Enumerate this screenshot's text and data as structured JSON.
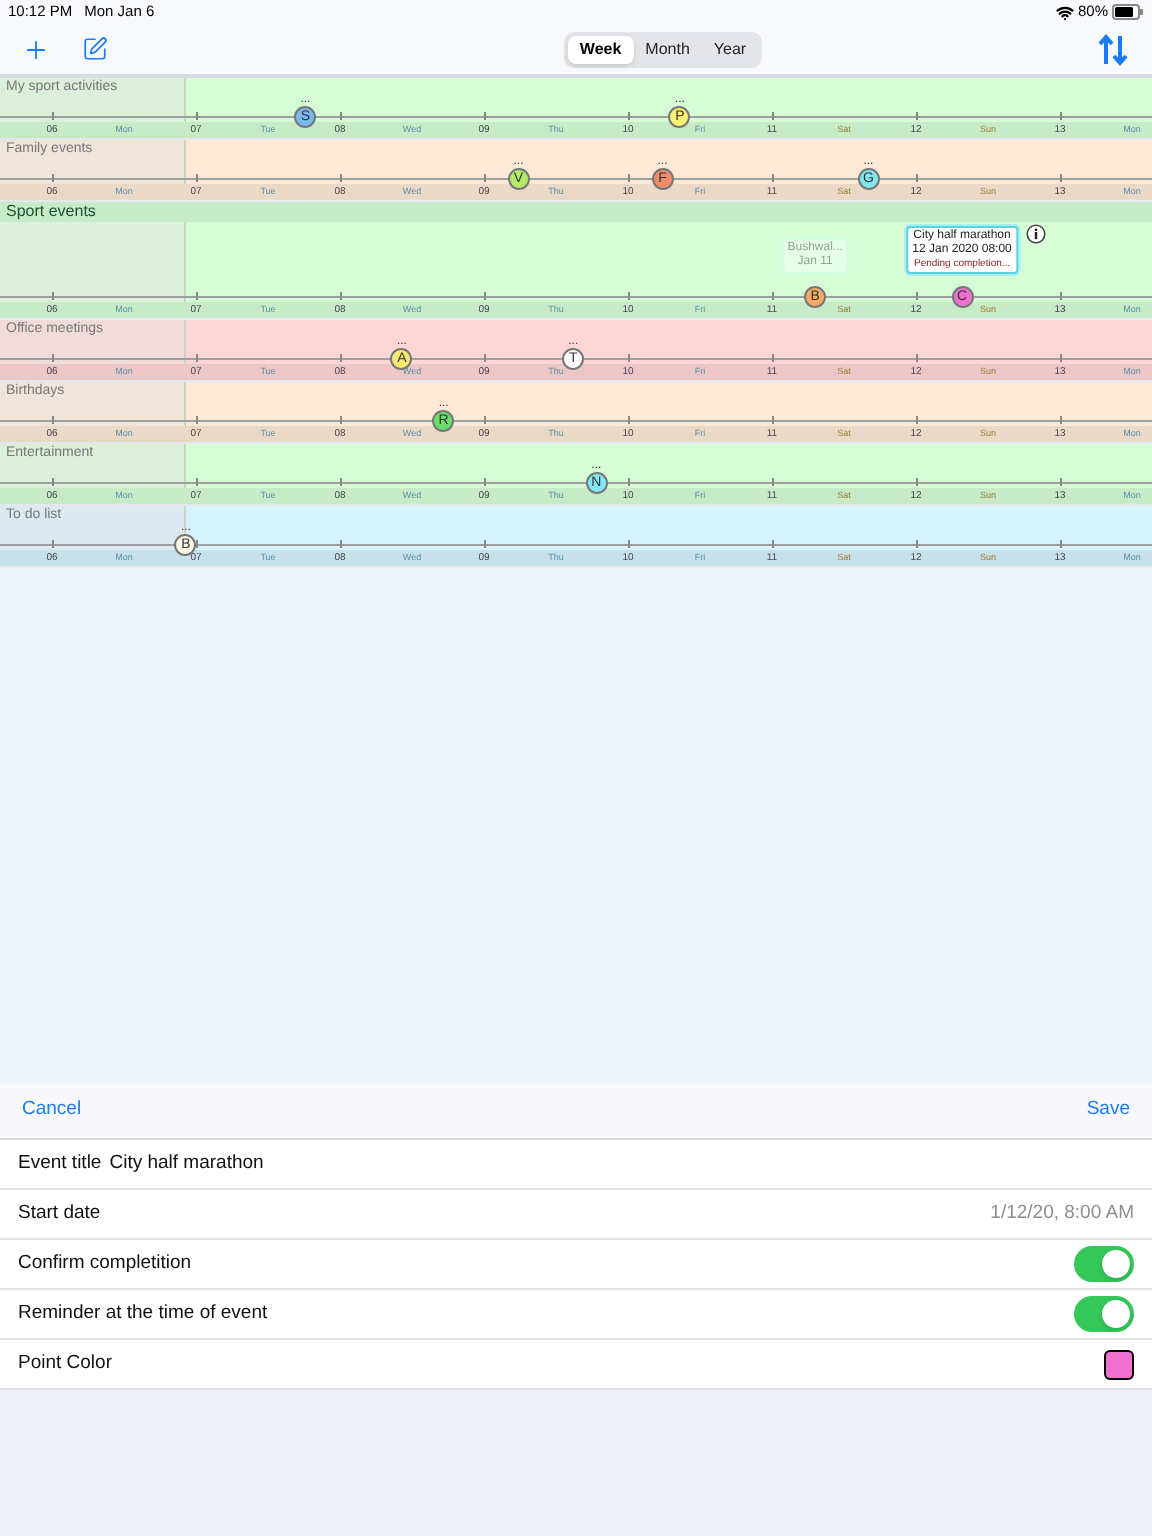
{
  "status_bar": {
    "time": "10:12 PM",
    "date": "Mon Jan 6",
    "battery": "80%"
  },
  "toolbar": {
    "segments": [
      {
        "label": "Week",
        "selected": true
      },
      {
        "label": "Month",
        "selected": false
      },
      {
        "label": "Year",
        "selected": false
      }
    ]
  },
  "timelines": [
    {
      "name": "My sport activities",
      "color": "#d6fcd6",
      "expanded": false,
      "dates": [
        "06",
        "07",
        "08",
        "09",
        "10",
        "11",
        "12",
        "13"
      ],
      "weekdays": [
        "Mon",
        "Tue",
        "Wed",
        "Thu",
        "Fri",
        "Sat",
        "Sun",
        "Mon"
      ],
      "points": [
        {
          "letter": "S",
          "color": "#7ab8f0",
          "more": "..."
        },
        {
          "letter": "P",
          "color": "#f8f270",
          "more": "..."
        }
      ]
    },
    {
      "name": "Family events",
      "color": "#fde9d6",
      "expanded": false,
      "dates": [
        "06",
        "07",
        "08",
        "09",
        "10",
        "11",
        "12",
        "13"
      ],
      "weekdays": [
        "Mon",
        "Tue",
        "Wed",
        "Thu",
        "Fri",
        "Sat",
        "Sun",
        "Mon"
      ],
      "points": [
        {
          "letter": "V",
          "color": "#b6ea6a",
          "more": "..."
        },
        {
          "letter": "F",
          "color": "#f08c6c",
          "more": "..."
        },
        {
          "letter": "G",
          "color": "#80e8f0",
          "more": "..."
        }
      ]
    },
    {
      "name": "Sport events",
      "color": "#d6fcd6",
      "expanded": true,
      "dates": [
        "06",
        "07",
        "08",
        "09",
        "10",
        "11",
        "12",
        "13"
      ],
      "weekdays": [
        "Mon",
        "Tue",
        "Wed",
        "Thu",
        "Fri",
        "Sat",
        "Sun",
        "Mon"
      ],
      "points": [
        {
          "letter": "B",
          "color": "#f6aa62",
          "tooltip": {
            "title": "Bushwal...",
            "date": "Jan 11",
            "faded": true
          }
        },
        {
          "letter": "C",
          "color": "#f070d0",
          "tooltip": {
            "title": "City half marathon",
            "date": "12 Jan 2020 08:00",
            "status": "Pending completion...",
            "faded": false,
            "info": true
          }
        }
      ]
    },
    {
      "name": "Office meetings",
      "color": "#ffd6d6",
      "expanded": false,
      "dates": [
        "06",
        "07",
        "08",
        "09",
        "10",
        "11",
        "12",
        "13"
      ],
      "weekdays": [
        "Mon",
        "Tue",
        "Wed",
        "Thu",
        "Fri",
        "Sat",
        "Sun",
        "Mon"
      ],
      "points": [
        {
          "letter": "A",
          "color": "#f8e872",
          "more": "..."
        },
        {
          "letter": "T",
          "color": "#ffffff",
          "more": "..."
        }
      ]
    },
    {
      "name": "Birthdays",
      "color": "#fde9d6",
      "expanded": false,
      "dates": [
        "06",
        "07",
        "08",
        "09",
        "10",
        "11",
        "12",
        "13"
      ],
      "weekdays": [
        "Mon",
        "Tue",
        "Wed",
        "Thu",
        "Fri",
        "Sat",
        "Sun",
        "Mon"
      ],
      "points": [
        {
          "letter": "R",
          "color": "#6ade6a",
          "more": "..."
        }
      ]
    },
    {
      "name": "Entertainment",
      "color": "#d6fcd6",
      "expanded": false,
      "dates": [
        "06",
        "07",
        "08",
        "09",
        "10",
        "11",
        "12",
        "13"
      ],
      "weekdays": [
        "Mon",
        "Tue",
        "Wed",
        "Thu",
        "Fri",
        "Sat",
        "Sun",
        "Mon"
      ],
      "points": [
        {
          "letter": "N",
          "color": "#80e8f8",
          "more": "..."
        }
      ]
    },
    {
      "name": "To do list",
      "color": "#d6f2fc",
      "expanded": false,
      "dates": [
        "06",
        "07",
        "08",
        "09",
        "10",
        "11",
        "12",
        "13"
      ],
      "weekdays": [
        "Mon",
        "Tue",
        "Wed",
        "Thu",
        "Fri",
        "Sat",
        "Sun",
        "Mon"
      ],
      "points": [
        {
          "letter": "B",
          "color": "#fff8e6",
          "more": "..."
        }
      ]
    }
  ],
  "sheet": {
    "cancel": "Cancel",
    "save": "Save",
    "rows": [
      {
        "kind": "field",
        "label": "Event title",
        "value": "City half marathon"
      },
      {
        "kind": "value",
        "label": "Start date",
        "value": "1/12/20, 8:00 AM"
      },
      {
        "kind": "switch",
        "label": "Confirm completition",
        "on": true
      },
      {
        "kind": "switch",
        "label": "Reminder at the time of event",
        "on": true
      },
      {
        "kind": "color",
        "label": "Point Color",
        "color": "#f070d0"
      }
    ]
  }
}
